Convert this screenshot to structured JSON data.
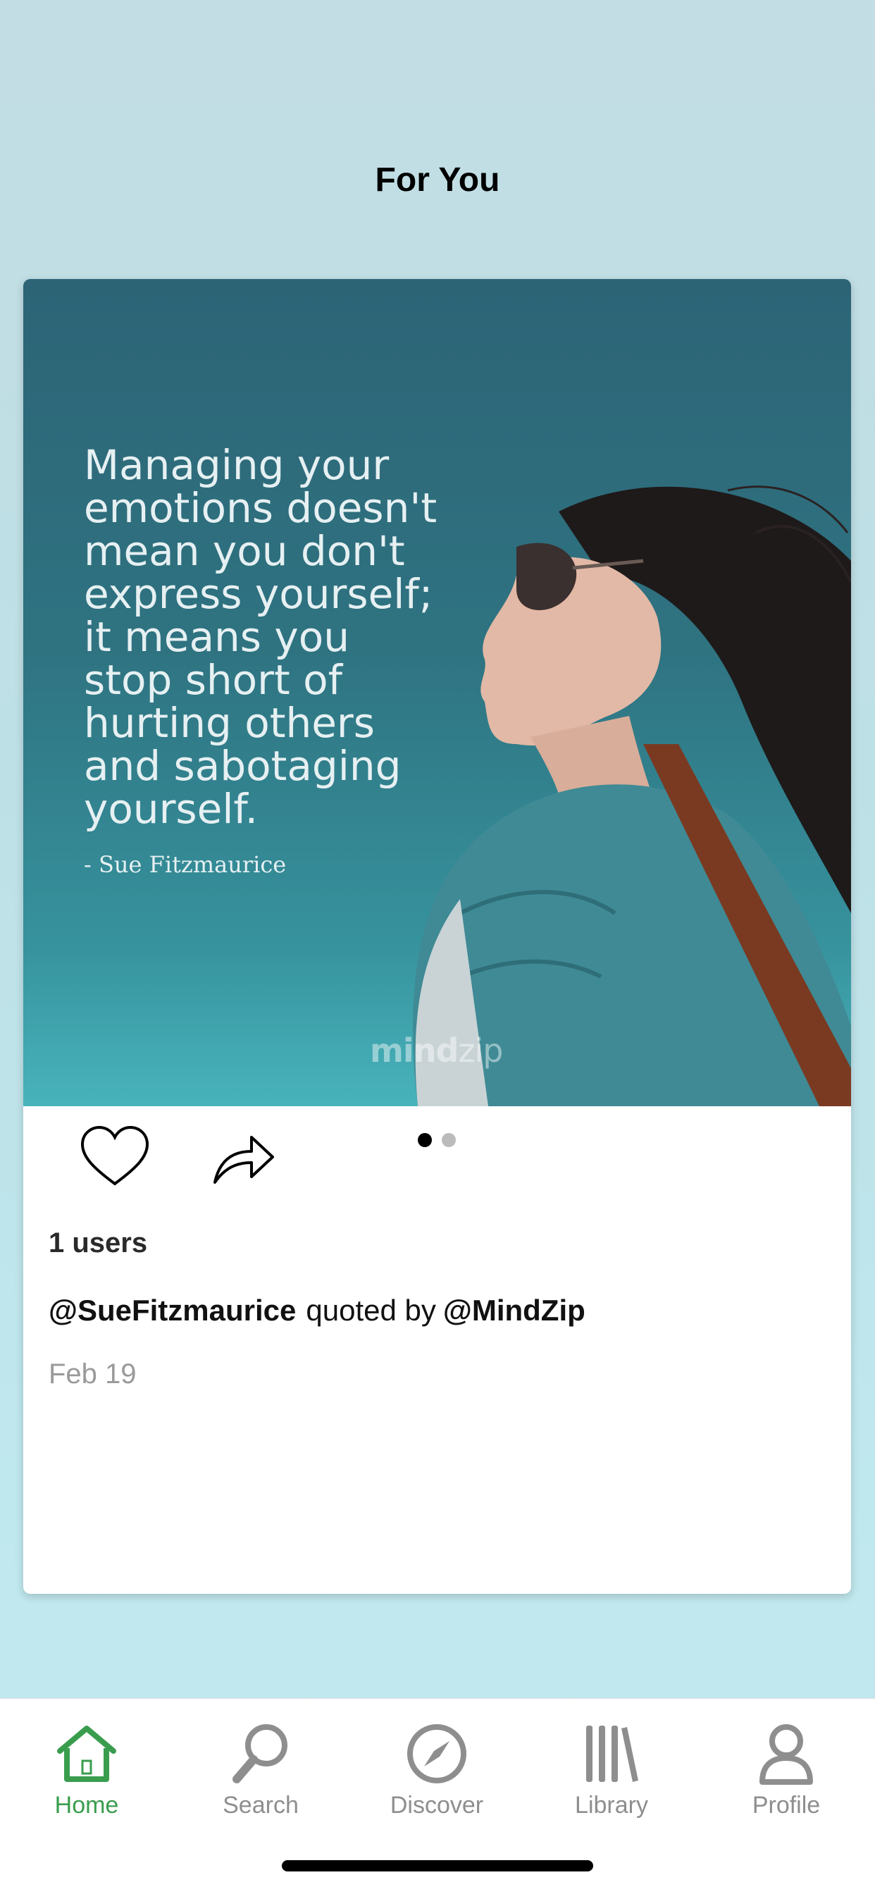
{
  "header": {
    "title": "For You"
  },
  "post": {
    "quote": "Managing your\nemotions doesn't\nmean you don't\nexpress yourself;\nit means you\nstop short of\nhurting others\nand sabotaging\nyourself.",
    "author": "- Sue Fitzmaurice",
    "watermark_bold": "mind",
    "watermark_light": "zip",
    "users_count": "1 users",
    "author_handle": "@SueFitzmaurice",
    "quoted_by_text": "quoted by",
    "quoter_handle": "@MindZip",
    "date": "Feb 19",
    "pager": {
      "count": 2,
      "active": 1
    }
  },
  "tabs": [
    {
      "label": "Home",
      "icon": "home-icon",
      "active": true
    },
    {
      "label": "Search",
      "icon": "search-icon",
      "active": false
    },
    {
      "label": "Discover",
      "icon": "compass-icon",
      "active": false
    },
    {
      "label": "Library",
      "icon": "library-icon",
      "active": false
    },
    {
      "label": "Profile",
      "icon": "profile-icon",
      "active": false
    }
  ],
  "colors": {
    "accent": "#3a9d4e",
    "inactive": "#8e8e8e",
    "card_image_bg": "#2f7381"
  }
}
